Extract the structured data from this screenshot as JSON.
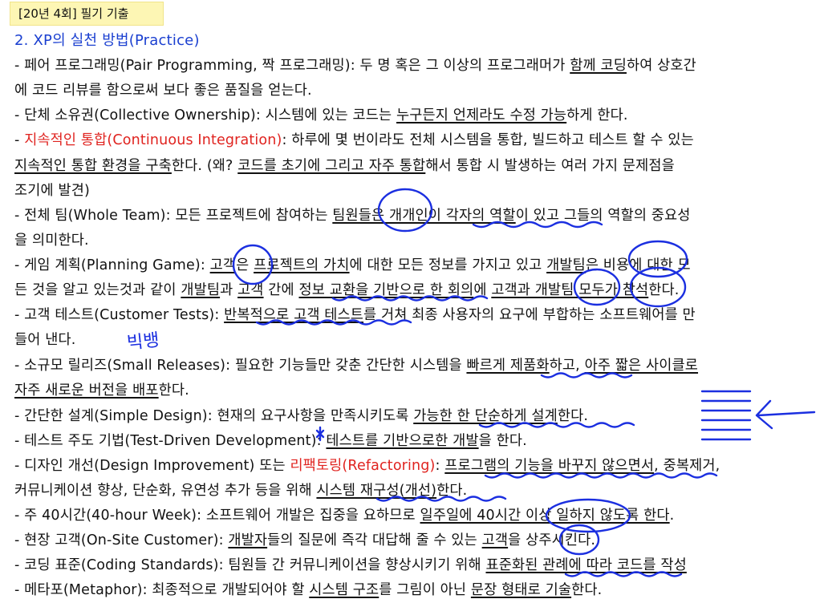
{
  "tag": "[20년 4회] 필기 기출",
  "heading": "2. XP의 실천 방법(Practice)",
  "lines": [
    [
      "- 페어 프로그래밍(Pair Programming,  짝 프로그래밍): 두 명 혹은 그 이상의 프로그래머가 ",
      "함께 코딩",
      "하여 상호간"
    ],
    [
      "에 코드 리뷰를 함으로써 보다 좋은 품질을 얻는다."
    ],
    [
      "- 단체 소유권(Collective Ownership): 시스템에 있는 코드는 ",
      "누구든지 언제라도 수정 가능",
      "하게 한다."
    ],
    [
      "- ",
      "지속적인 통합(Continuous Integration)",
      ": 하루에 몇 번이라도 전체 시스템을 통합, 빌드하고 테스트 할 수 있는"
    ],
    [
      "지속적인 통합 환경을 구축",
      "한다. (왜? ",
      "코드를 초기에 그리고 자주 통합",
      "해서 통합 시 발생하는 여러 가지 문제점을"
    ],
    [
      "조기에 발견)"
    ],
    [
      "- 전체 팀(Whole Team): 모든 프로젝트에 참여하는 ",
      "팀원들은 개개인이 각자의 역할",
      "이 있고 그들의 역할의 중요성"
    ],
    [
      "을 의미한다."
    ],
    [
      "- 게임 계획(Planning Game): ",
      "고객",
      "은 ",
      "프로젝트의 가치",
      "에 대한 모든 정보를 가지고 있고 ",
      "개발팀",
      "은 비용에 대한 모"
    ],
    [
      "든 것을 알고 있는것과 같이 ",
      "개발팀",
      "과 ",
      "고객",
      " 간에 ",
      "정보 교환을 기반으로 한 회의",
      "에 ",
      "고객과 개발팀 모두가 참석",
      "한다."
    ],
    [
      "- 고객 테스트(Customer Tests): ",
      "반복적으로 고객 테스트",
      "를 거쳐 최종 사용자의 요구에 부합하는 소프트웨어를 만"
    ],
    [
      "들어 낸다."
    ],
    [
      "- 소규모 릴리즈(Small Releases): 필요한 기능들만 갖춘 간단한 시스템을 ",
      "빠르게 제품화",
      "하고, ",
      "아주 짧은 사이클로"
    ],
    [
      "자주 새로운 버전을 배포",
      "한다."
    ],
    [
      "- 간단한 설계(Simple Design): 현재의 요구사항을 만족시키도록 ",
      "가능한 한 단순하게 설계",
      "한다."
    ],
    [
      "- 테스트 주도 기법(Test-Driven Development): ",
      "테스트를 기반으로한 개발",
      "을 한다."
    ],
    [
      "- 디자인 개선(Design Improvement) 또는 ",
      "리팩토링(Refactoring)",
      ": ",
      "프로그램의 기능을 바꾸지 않으면서",
      ", 중복제거,"
    ],
    [
      "커뮤니케이션 향상, 단순화, 유연성 추가 등을 위해 ",
      "시스템 재구성(개선)",
      "한다."
    ],
    [
      "- 주 40시간(40-hour Week): 소프트웨어 개발은 집중을 요하므로 ",
      "일주일에 40시간 이상 일하지 않도록 한다",
      "."
    ],
    [
      "- 현장 고객(On-Site Customer): ",
      "개발자",
      "들의 질문에 즉각 대답해 줄 수 있는 ",
      "고객",
      "을 상주시킨다."
    ],
    [
      "- 코딩 표준(Coding Standards): 팀원들 간 커뮤니케이션을 향상시키기 위해 ",
      "표준화된 관례에 따라 코드를 작성"
    ],
    [
      "- 메타포(Metaphor): 최종적으로 개발되어야 할 ",
      "시스템 구조",
      "를 그림이 아닌 ",
      "문장 형태로 기술",
      "한다."
    ]
  ],
  "handwriting": {
    "small_release_note": "빅뱅"
  }
}
